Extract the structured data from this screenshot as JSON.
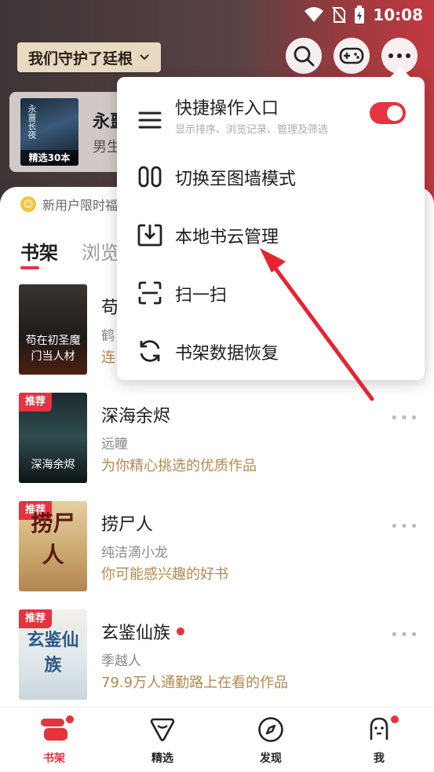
{
  "status_bar": {
    "time": "10:08"
  },
  "header": {
    "title": "我们守护了廷根",
    "featured": {
      "title": "永噩",
      "subtitle": "男生月",
      "cover_badge": "精选30本",
      "cover_script": "永噩长夜"
    }
  },
  "promo": {
    "icon_text": "☺",
    "text": "新用户限时福"
  },
  "tabs": [
    {
      "label": "书架",
      "active": true
    },
    {
      "label": "浏览"
    }
  ],
  "books": [
    {
      "title": "苟",
      "author": "鹤",
      "desc": "连",
      "badge": "",
      "cover_text": "苟在初圣魔门当人材"
    },
    {
      "title": "深海余烬",
      "author": "远瞳",
      "desc": "为你精心挑选的优质作品",
      "badge": "推荐",
      "cover_text": "深海余烬"
    },
    {
      "title": "捞尸人",
      "author": "纯洁滴小龙",
      "desc": "你可能感兴趣的好书",
      "badge": "推荐",
      "cover_text": "捞尸人"
    },
    {
      "title": "玄鉴仙族",
      "author": "季越人",
      "desc": "79.9万人通勤路上在看的作品",
      "badge": "推荐",
      "cover_text": "玄鉴仙族"
    }
  ],
  "more_glyph": "•••",
  "menu": {
    "items": [
      {
        "label": "快捷操作入口",
        "sub": "显示排序、浏览记录、管理及筛选",
        "toggle_on": true
      },
      {
        "label": "切换至图墙模式"
      },
      {
        "label": "本地书云管理"
      },
      {
        "label": "扫一扫"
      },
      {
        "label": "书架数据恢复"
      }
    ]
  },
  "bottom_nav": [
    {
      "label": "书架",
      "icon": "bookshelf-icon",
      "active": true
    },
    {
      "label": "精选",
      "icon": "diamond-icon"
    },
    {
      "label": "发现",
      "icon": "compass-icon"
    },
    {
      "label": "我",
      "icon": "profile-icon"
    }
  ],
  "colors": {
    "accent": "#e53340",
    "gold_text": "#b3894e",
    "header_pill": "#e8dac1"
  }
}
